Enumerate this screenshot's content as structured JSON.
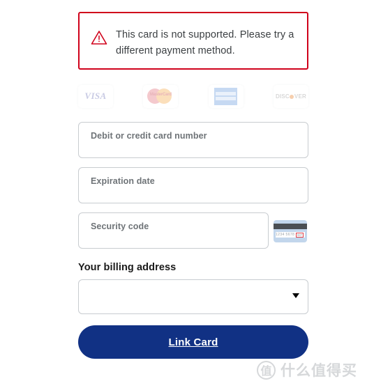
{
  "error": {
    "icon": "warning-triangle-icon",
    "message": "This card is not supported. Please try a different payment method.",
    "border_color": "#d0021b"
  },
  "card_brands": [
    {
      "name": "visa",
      "label": "VISA"
    },
    {
      "name": "mastercard",
      "label": "MasterCard"
    },
    {
      "name": "amex",
      "label": "AMERICAN EXPRESS"
    },
    {
      "name": "discover",
      "label_before": "DISC",
      "label_after": "VER"
    }
  ],
  "fields": {
    "card_number": {
      "label": "Debit or credit card number",
      "value": ""
    },
    "expiration": {
      "label": "Expiration date",
      "value": ""
    },
    "security_code": {
      "label": "Security code",
      "value": ""
    }
  },
  "cvv_hint": {
    "icon": "credit-card-back-icon",
    "digits": "1234 5678",
    "highlight": "987"
  },
  "billing": {
    "heading": "Your billing address",
    "selected_option": "",
    "arrow_icon": "chevron-down-icon"
  },
  "submit": {
    "label": "Link Card",
    "background": "#113184"
  },
  "watermark": {
    "logo": "值",
    "text": "什么值得买"
  }
}
